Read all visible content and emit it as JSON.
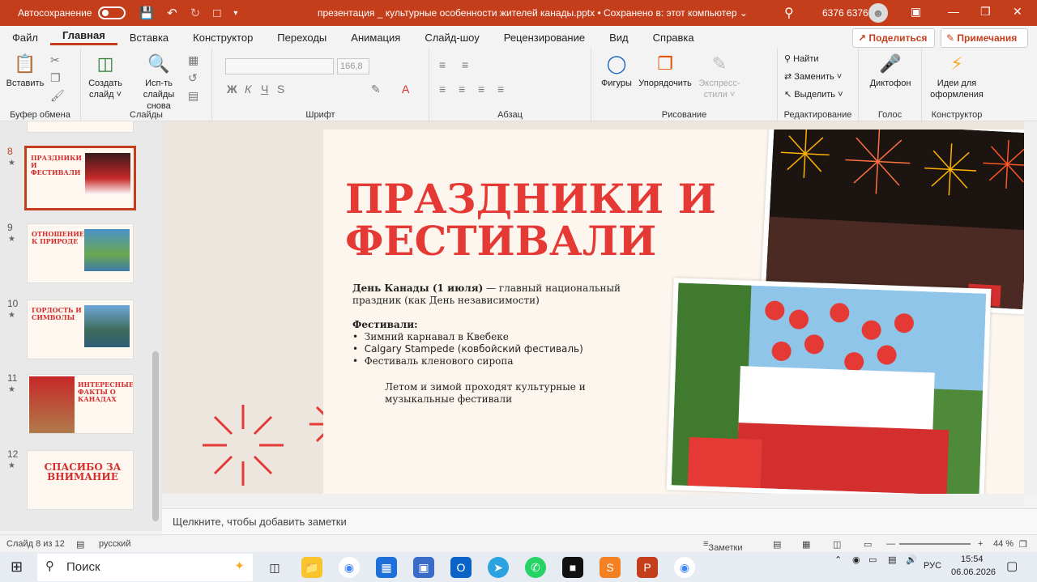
{
  "titlebar": {
    "autosave_label": "Автосохранение",
    "doc_title": "презентация _ культурные особенности жителей канады.pptx  •  Сохранено в: этот компьютер  ⌄",
    "user_name": "6376 6376"
  },
  "menu": {
    "tabs": [
      "Файл",
      "Главная",
      "Вставка",
      "Конструктор",
      "Переходы",
      "Анимация",
      "Слайд-шоу",
      "Рецензирование",
      "Вид",
      "Справка"
    ],
    "share": "Поделиться",
    "comments": "Примечания"
  },
  "ribbon": {
    "paste": "Вставить",
    "new_slide": "Создать слайд ˅",
    "reuse_slides": "Исп-ть слайды снова",
    "font_size": "166,8",
    "shapes": "Фигуры",
    "arrange": "Упорядочить",
    "quick_styles": "Экспресс-стили ˅",
    "find": "Найти",
    "replace": "Заменить ˅",
    "select": "Выделить ˅",
    "dictate": "Диктофон",
    "designer": "Идеи для оформления",
    "groups": {
      "clipboard": "Буфер обмена",
      "slides": "Слайды",
      "font": "Шрифт",
      "paragraph": "Абзац",
      "drawing": "Рисование",
      "editing": "Редактирование",
      "voice": "Голос",
      "designer": "Конструктор"
    }
  },
  "thumbnails": [
    {
      "num": "8",
      "title": "ПРАЗДНИКИ И ФЕСТИВАЛИ",
      "active": true
    },
    {
      "num": "9",
      "title": "ОТНОШЕНИЕ К ПРИРОДЕ",
      "active": false
    },
    {
      "num": "10",
      "title": "ГОРДОСТЬ И СИМВОЛЫ",
      "active": false
    },
    {
      "num": "11",
      "title": "ИНТЕРЕСНЫЕ ФАКТЫ О КАНАДАХ",
      "active": false
    },
    {
      "num": "12",
      "title": "СПАСИБО ЗА ВНИМАНИЕ",
      "active": false
    }
  ],
  "slide": {
    "title_line1": "ПРАЗДНИКИ И",
    "title_line2": "ФЕСТИВАЛИ",
    "day_bold": "День Канады (1 июля)",
    "day_rest": " — главный национальный",
    "day_line2": "праздник (как День независимости)",
    "festivals_heading": "Фестивали:",
    "festivals": [
      "Зимний карнавал в Квебеке",
      "Calgary Stampede (ковбойский фестиваль)",
      "Фестиваль кленового сиропа"
    ],
    "summary_line1": "Летом и зимой проходят культурные и",
    "summary_line2": "музыкальные фестивали"
  },
  "notes_placeholder": "Щелкните, чтобы добавить заметки",
  "status": {
    "slide_counter": "Слайд 8 из 12",
    "language": "русский",
    "notes_button": "Заметки",
    "zoom": "44 %"
  },
  "taskbar": {
    "search": "Поиск",
    "language": "РУС",
    "time": "15:54",
    "date": "06.06.2026"
  },
  "colors": {
    "accent": "#c43e1c",
    "slide_title": "#e53935"
  }
}
